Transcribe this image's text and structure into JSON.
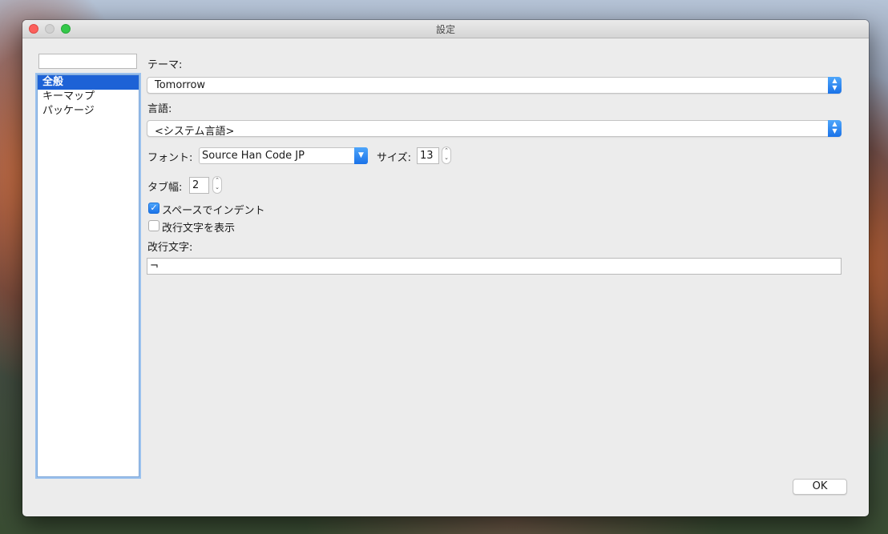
{
  "window": {
    "title": "設定"
  },
  "sidebar": {
    "search_value": "",
    "items": [
      {
        "label": "全般",
        "selected": true
      },
      {
        "label": "キーマップ",
        "selected": false
      },
      {
        "label": "パッケージ",
        "selected": false
      }
    ]
  },
  "general": {
    "theme_label": "テーマ:",
    "theme_value": "Tomorrow",
    "language_label": "言語:",
    "language_value": "<システム言語>",
    "font_label": "フォント:",
    "font_value": "Source Han Code JP",
    "size_label": "サイズ:",
    "size_value": "13",
    "tab_width_label": "タブ幅:",
    "tab_width_value": "2",
    "indent_with_spaces_label": "スペースでインデント",
    "indent_with_spaces_checked": true,
    "show_newline_label": "改行文字を表示",
    "show_newline_checked": false,
    "newline_char_label": "改行文字:",
    "newline_char_value": "¬"
  },
  "footer": {
    "ok_label": "OK"
  },
  "colors": {
    "accent": "#1d62d6",
    "close": "#fc605c",
    "minimize": "#d1d1d1",
    "maximize": "#34c84a"
  }
}
